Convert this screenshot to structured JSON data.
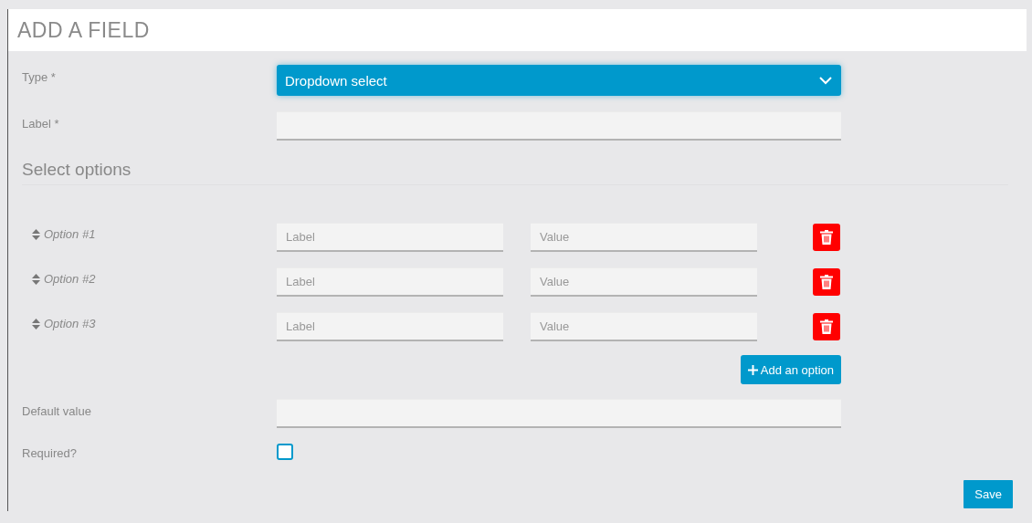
{
  "title": "ADD A FIELD",
  "type_field": {
    "label": "Type *",
    "value": "Dropdown select"
  },
  "label_field": {
    "label": "Label *"
  },
  "section_title": "Select options",
  "options": [
    {
      "name": "Option #1",
      "label_placeholder": "Label",
      "value_placeholder": "Value"
    },
    {
      "name": "Option #2",
      "label_placeholder": "Label",
      "value_placeholder": "Value"
    },
    {
      "name": "Option #3",
      "label_placeholder": "Label",
      "value_placeholder": "Value"
    }
  ],
  "add_option_button": "Add an option",
  "default_value_field": {
    "label": "Default value"
  },
  "required_field": {
    "label": "Required?",
    "checked": false
  },
  "save_button": "Save"
}
